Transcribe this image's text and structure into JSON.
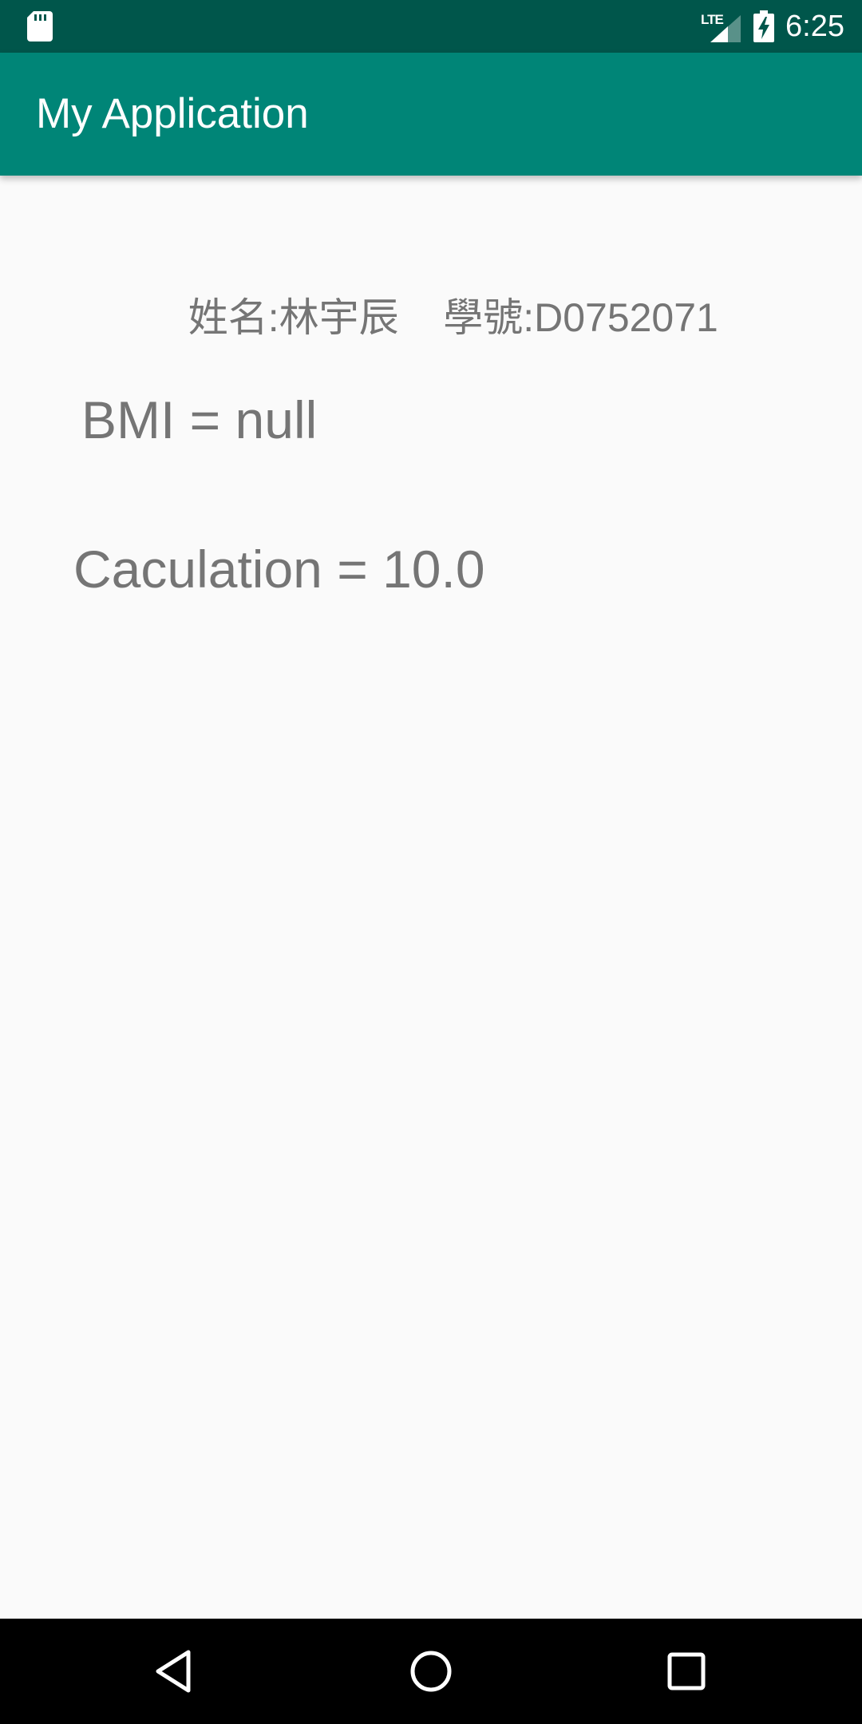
{
  "status_bar": {
    "time": "6:25",
    "network_label": "LTE",
    "icons": [
      "sd-card-icon",
      "lte-signal-icon",
      "battery-charging-icon"
    ]
  },
  "app_bar": {
    "title": "My Application",
    "color": "#008577"
  },
  "main": {
    "name_label": "姓名:林宇辰",
    "student_id_label": "學號:D0752071",
    "bmi_text": "BMI = null",
    "calculation_text": "Caculation = 10.0",
    "text_color": "#757575"
  },
  "nav_bar": {
    "icons": [
      "back-icon",
      "home-icon",
      "recents-icon"
    ]
  }
}
